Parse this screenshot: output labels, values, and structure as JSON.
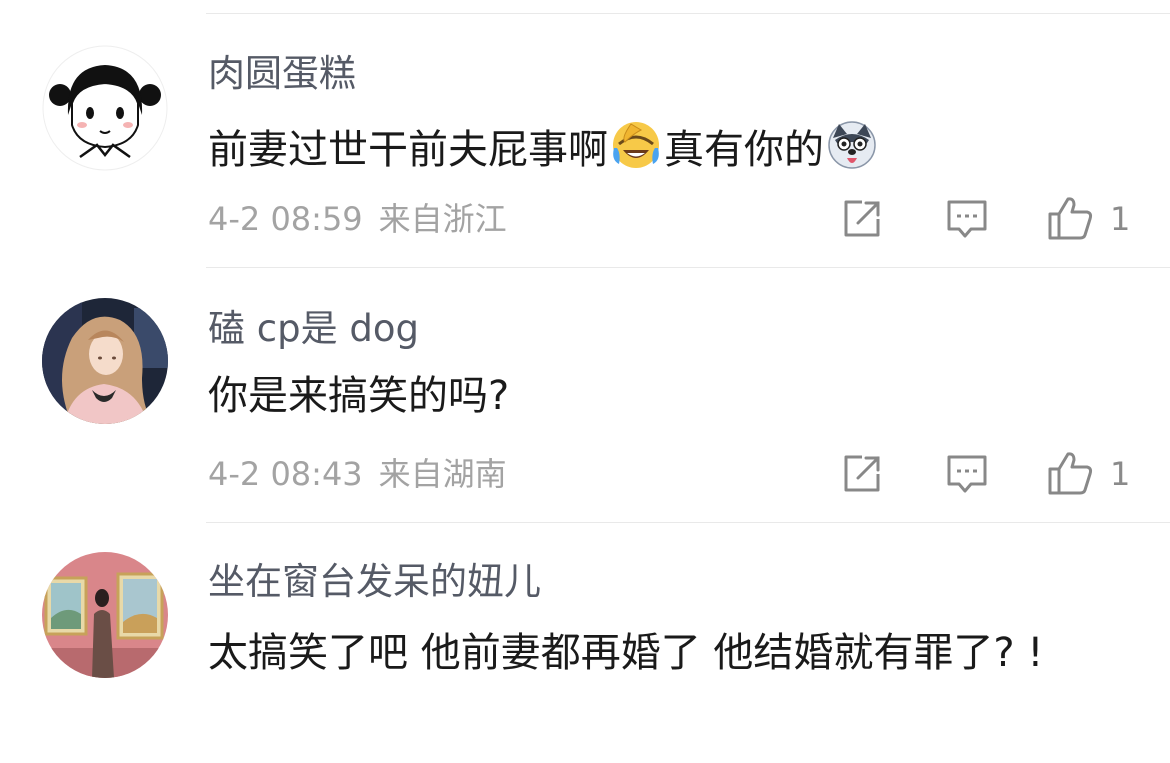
{
  "comments": [
    {
      "username": "肉圆蛋糕",
      "text_part1": "前妻过世干前夫屁事啊",
      "emoji1": "laughing-tears-emoji",
      "text_part2": "真有你的",
      "emoji2": "husky-dog-emoji",
      "date": "4-2 08:59",
      "location": "来自浙江",
      "likes": "1"
    },
    {
      "username": "磕 cp是 dog",
      "text": "你是来搞笑的吗?",
      "date": "4-2 08:43",
      "location": "来自湖南",
      "likes": "1"
    },
    {
      "username": "坐在窗台发呆的妞儿",
      "text": "太搞笑了吧 他前妻都再婚了 他结婚就有罪了? !"
    }
  ],
  "icons": {
    "share": "share-icon",
    "reply": "reply-icon",
    "like": "thumbs-up-icon"
  },
  "colors": {
    "username": "#555a66",
    "meta": "#a3a3a3",
    "icon": "#888888",
    "text": "#1a1a1a"
  }
}
